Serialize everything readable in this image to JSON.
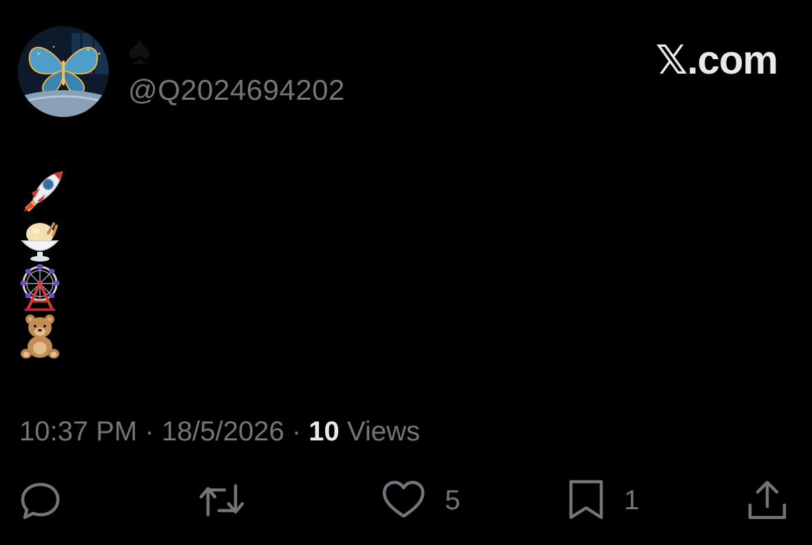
{
  "author": {
    "display_name": "♠",
    "handle": "@Q2024694202"
  },
  "brand": {
    "label": "𝕏.com"
  },
  "tweet": {
    "emojis": [
      {
        "icon": "rocket-emoji"
      },
      {
        "icon": "ice-cream-emoji"
      },
      {
        "icon": "ferris-wheel-emoji"
      },
      {
        "icon": "teddy-bear-emoji"
      }
    ]
  },
  "meta": {
    "time": "10:37 PM",
    "sep1": " · ",
    "date": "18/5/2026",
    "sep2": " · ",
    "views_count": "10",
    "views_label": " Views"
  },
  "actions": {
    "reply": {
      "icon": "reply-icon",
      "count": ""
    },
    "repost": {
      "icon": "repost-icon",
      "count": ""
    },
    "like": {
      "icon": "heart-icon",
      "count": "5"
    },
    "bookmark": {
      "icon": "bookmark-icon",
      "count": "1"
    },
    "share": {
      "icon": "share-icon",
      "count": ""
    }
  },
  "colors": {
    "background": "#000000",
    "primary_text": "#e7e9ea",
    "secondary_text": "#71767b"
  }
}
